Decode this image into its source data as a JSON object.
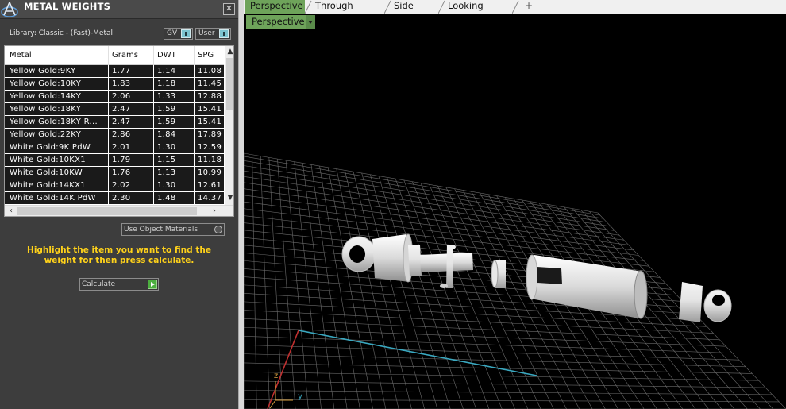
{
  "panel": {
    "title": "METAL WEIGHTS",
    "close_label": "✕",
    "library_label": "Library: Classic - (Fast)-Metal",
    "gv_toggle": "GV",
    "user_toggle": "User"
  },
  "table": {
    "columns": [
      "Metal",
      "Grams",
      "DWT",
      "SPG"
    ],
    "rows": [
      {
        "metal": "Yellow Gold:9KY",
        "grams": "1.77",
        "dwt": "1.14",
        "spg": "11.08"
      },
      {
        "metal": "Yellow Gold:10KY",
        "grams": "1.83",
        "dwt": "1.18",
        "spg": "11.45"
      },
      {
        "metal": "Yellow Gold:14KY",
        "grams": "2.06",
        "dwt": "1.33",
        "spg": "12.88"
      },
      {
        "metal": "Yellow Gold:18KY",
        "grams": "2.47",
        "dwt": "1.59",
        "spg": "15.41"
      },
      {
        "metal": "Yellow Gold:18KY R...",
        "grams": "2.47",
        "dwt": "1.59",
        "spg": "15.41"
      },
      {
        "metal": "Yellow Gold:22KY",
        "grams": "2.86",
        "dwt": "1.84",
        "spg": "17.89"
      },
      {
        "metal": "White Gold:9K PdW",
        "grams": "2.01",
        "dwt": "1.30",
        "spg": "12.59"
      },
      {
        "metal": "White Gold:10KX1",
        "grams": "1.79",
        "dwt": "1.15",
        "spg": "11.18"
      },
      {
        "metal": "White Gold:10KW",
        "grams": "1.76",
        "dwt": "1.13",
        "spg": "10.99"
      },
      {
        "metal": "White Gold:14KX1",
        "grams": "2.02",
        "dwt": "1.30",
        "spg": "12.61"
      },
      {
        "metal": "White Gold:14K PdW",
        "grams": "2.30",
        "dwt": "1.48",
        "spg": "14.37"
      }
    ]
  },
  "controls": {
    "use_object_materials": "Use Object Materials",
    "instructions": "Highlight the item you want to find the weight for then press calculate.",
    "calculate_label": "Calculate"
  },
  "tabs": [
    "Perspective",
    "Through Finger",
    "Side View",
    "Looking Down"
  ],
  "tab_add_label": "+",
  "viewport": {
    "view_mode": "Perspective",
    "axis_z": "z",
    "axis_y": "y"
  },
  "colors": {
    "accent_green": "#6ea35a",
    "highlight_text": "#ffd21a",
    "grid_line": "#6b6b6b",
    "axis_x": "#c03030",
    "axis_y": "#3aa8c0",
    "axis_z": "#d8a040"
  }
}
